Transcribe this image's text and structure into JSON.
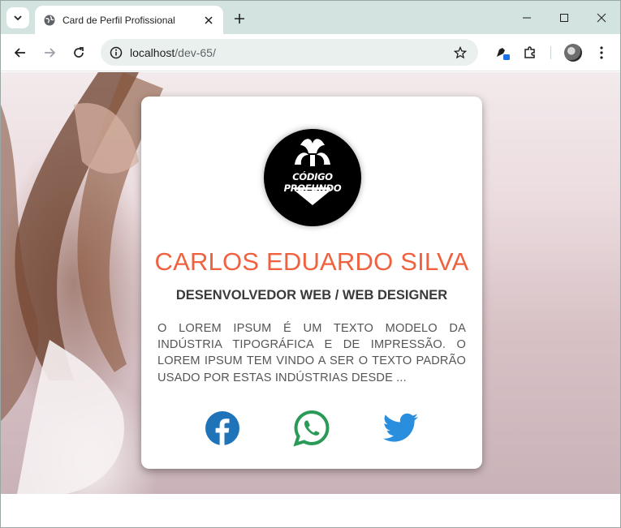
{
  "browser": {
    "tab_title": "Card de Perfil Profissional",
    "url_host": "localhost",
    "url_path": "/dev-65/",
    "accent": "#d3e3df"
  },
  "profile": {
    "logo_text": "CÓDIGO PROFUNDO",
    "name": "CARLOS EDUARDO SILVA",
    "role": "DESENVOLVEDOR WEB / WEB DESIGNER",
    "bio": "O lorem ipsum é um texto modelo da indústria tipográfica e de impressão. O lorem ipsum tem vindo a ser o texto padrão usado por estas indústrias desde ...",
    "name_color": "#f0613f",
    "social": [
      {
        "icon": "facebook-icon",
        "color": "#1e73b9"
      },
      {
        "icon": "whatsapp-icon",
        "color": "#2a9a57"
      },
      {
        "icon": "twitter-icon",
        "color": "#2a8ede"
      }
    ]
  }
}
